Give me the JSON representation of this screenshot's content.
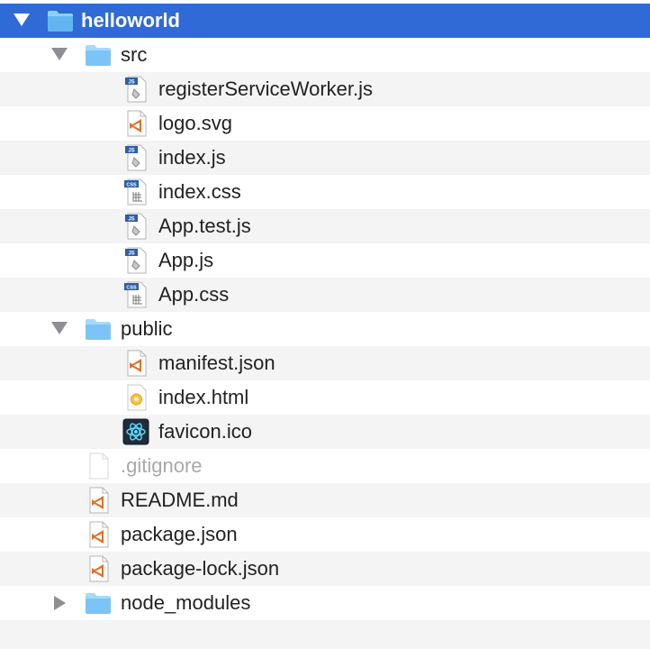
{
  "tree": {
    "root": {
      "label": "helloworld",
      "icon": "folder-icon",
      "expanded": true,
      "selected": true
    },
    "src": {
      "label": "src",
      "icon": "folder-icon",
      "expanded": true,
      "files": [
        {
          "label": "registerServiceWorker.js",
          "icon": "js-file-icon"
        },
        {
          "label": "logo.svg",
          "icon": "vscode-file-icon"
        },
        {
          "label": "index.js",
          "icon": "js-file-icon"
        },
        {
          "label": "index.css",
          "icon": "css-file-icon"
        },
        {
          "label": "App.test.js",
          "icon": "js-file-icon"
        },
        {
          "label": "App.js",
          "icon": "js-file-icon"
        },
        {
          "label": "App.css",
          "icon": "css-file-icon"
        }
      ]
    },
    "public": {
      "label": "public",
      "icon": "folder-icon",
      "expanded": true,
      "files": [
        {
          "label": "manifest.json",
          "icon": "vscode-file-icon"
        },
        {
          "label": "index.html",
          "icon": "html-file-icon"
        },
        {
          "label": "favicon.ico",
          "icon": "react-icon"
        }
      ]
    },
    "root_files": [
      {
        "label": ".gitignore",
        "icon": "blank-file-icon",
        "dimmed": true
      },
      {
        "label": "README.md",
        "icon": "vscode-file-icon"
      },
      {
        "label": "package.json",
        "icon": "vscode-file-icon"
      },
      {
        "label": "package-lock.json",
        "icon": "vscode-file-icon"
      }
    ],
    "node_modules": {
      "label": "node_modules",
      "icon": "folder-icon",
      "expanded": false
    }
  },
  "colors": {
    "selection": "#2f6ad7",
    "stripe": "#f4f4f5",
    "folder": "#7cc4f5",
    "dimmed_text": "#a9a9a9",
    "vscode_orange": "#e36f25"
  }
}
